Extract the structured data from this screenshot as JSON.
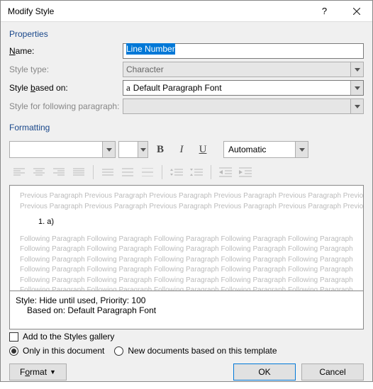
{
  "titlebar": {
    "title": "Modify Style"
  },
  "sections": {
    "properties": "Properties",
    "formatting": "Formatting"
  },
  "props": {
    "name_label": "Name:",
    "name_value": "Line Number",
    "type_label": "Style type:",
    "type_value": "Character",
    "based_label": "Style based on:",
    "based_value": "Default Paragraph Font",
    "following_label": "Style for following paragraph:",
    "following_value": ""
  },
  "formatting": {
    "bold": "B",
    "italic": "I",
    "underline": "U",
    "auto_label": "Automatic"
  },
  "preview": {
    "prev_text": "Previous Paragraph Previous Paragraph Previous Paragraph Previous Paragraph Previous Paragraph Previous Paragraph Previous Paragraph Previous Paragraph Previous Paragraph Previous Paragraph",
    "sample": "1.          a)",
    "follow_text": "Following Paragraph Following Paragraph Following Paragraph Following Paragraph Following Paragraph"
  },
  "description": {
    "line1": "Style: Hide until used, Priority: 100",
    "line2": "Based on: Default Paragraph Font"
  },
  "options": {
    "add_gallery": "Add to the Styles gallery",
    "only_doc": "Only in this document",
    "new_docs": "New documents based on this template"
  },
  "footer": {
    "format": "Format",
    "ok": "OK",
    "cancel": "Cancel"
  }
}
